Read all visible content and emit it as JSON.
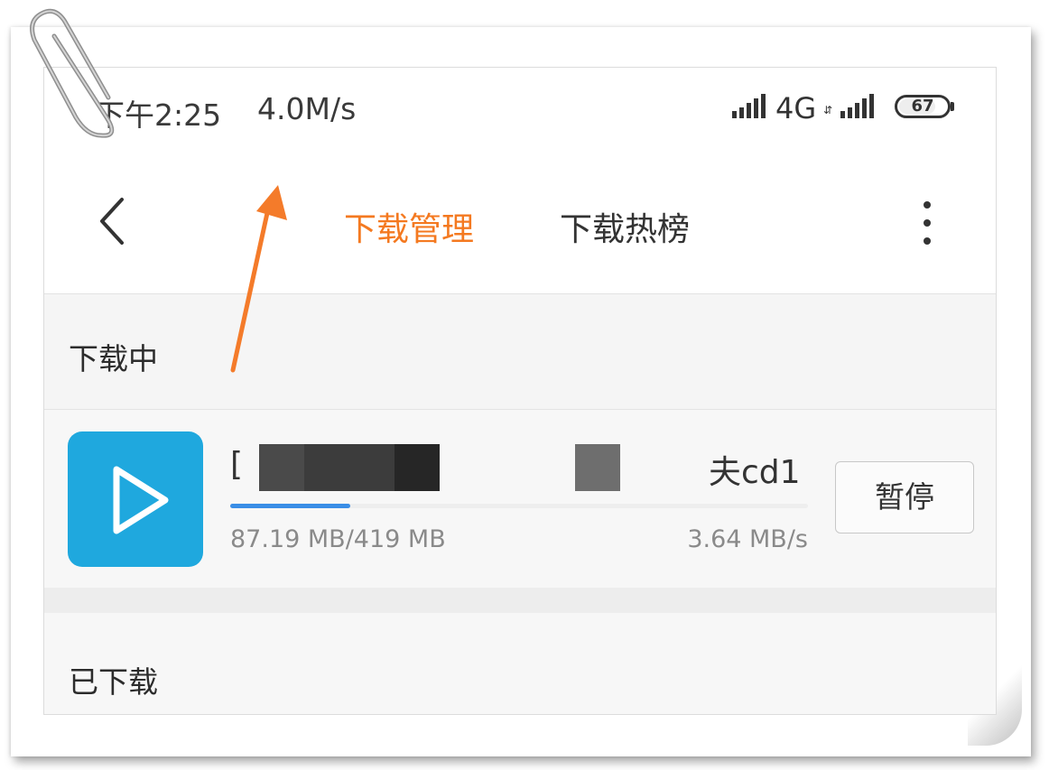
{
  "status_bar": {
    "time": "下午2:25",
    "net_speed": "4.0M/s",
    "network": "4G",
    "network_arrows": "⇵",
    "battery": "67"
  },
  "header": {
    "back_icon": "chevron-left-icon",
    "tabs": [
      {
        "label": "下载管理",
        "active": true
      },
      {
        "label": "下载热榜",
        "active": false
      }
    ],
    "more_icon": "more-vertical-icon"
  },
  "sections": {
    "downloading": "下载中",
    "downloaded": "已下载"
  },
  "download_item": {
    "icon": "play-icon",
    "title_start": "[",
    "title_end": "夫cd1",
    "progress": 0.208,
    "size": "87.19 MB/419 MB",
    "rate": "3.64 MB/s",
    "pause_label": "暂停"
  },
  "colors": {
    "accent": "#f47920",
    "app_icon": "#1fa8de",
    "progress": "#3a8ee6",
    "annotation_arrow": "#f47b2a"
  }
}
